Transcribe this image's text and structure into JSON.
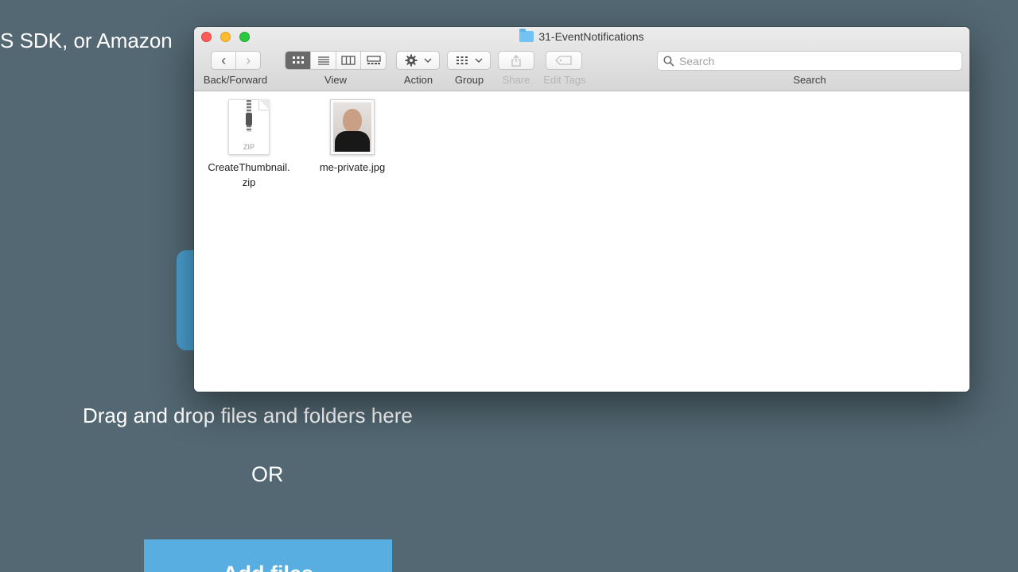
{
  "background_page": {
    "cut_text": "S SDK, or Amazon",
    "drag_text": "Drag and drop files and folders here",
    "or_text": "OR",
    "add_button_label": "Add files"
  },
  "finder": {
    "title": "31-EventNotifications",
    "toolbar": {
      "back_icon": "‹",
      "forward_icon": "›",
      "back_forward_label": "Back/Forward",
      "view_label": "View",
      "action_label": "Action",
      "group_label": "Group",
      "share_label": "Share",
      "edit_tags_label": "Edit Tags",
      "search_label": "Search",
      "search_placeholder": "Search"
    },
    "files": [
      {
        "name_line1": "CreateThumbnail.",
        "name_line2": "zip",
        "badge": "ZIP",
        "icon": "zip-archive-icon"
      },
      {
        "name": "me-private.jpg",
        "icon": "jpg-thumbnail-icon"
      }
    ]
  },
  "colors": {
    "desktop_bg": "#536873",
    "drop_zone_blue": "#4a9fcf",
    "add_button_blue": "#58aee0",
    "traffic_close": "#fc5c57",
    "traffic_minimize": "#fdbb2e",
    "traffic_maximize": "#2ac840",
    "folder_blue": "#72c3f4"
  }
}
